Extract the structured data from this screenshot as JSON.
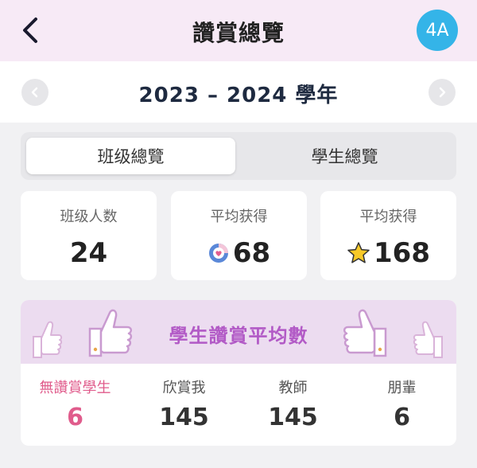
{
  "header": {
    "title": "讚賞總覽",
    "class_badge": "4A"
  },
  "year": {
    "label": "2023 – 2024 學年"
  },
  "tabs": [
    {
      "label": "班级總覽",
      "active": true
    },
    {
      "label": "學生總覽",
      "active": false
    }
  ],
  "stats": [
    {
      "label": "班级人数",
      "value": "24",
      "icon": null
    },
    {
      "label": "平均获得",
      "value": "68",
      "icon": "heart-badge-icon"
    },
    {
      "label": "平均获得",
      "value": "168",
      "icon": "star-icon"
    }
  ],
  "praise": {
    "title": "學生讚賞平均數",
    "columns": [
      {
        "label": "無讚賞學生",
        "value": "6",
        "highlight_color": "#e05c8c"
      },
      {
        "label": "欣賞我",
        "value": "145"
      },
      {
        "label": "教師",
        "value": "145"
      },
      {
        "label": "朋輩",
        "value": "6"
      }
    ]
  },
  "colors": {
    "header_bg": "#f7eaf6",
    "badge": "#34b4e8",
    "praise_banner": "#ecdcf0",
    "praise_title": "#b25ac6",
    "highlight": "#e05c8c"
  }
}
